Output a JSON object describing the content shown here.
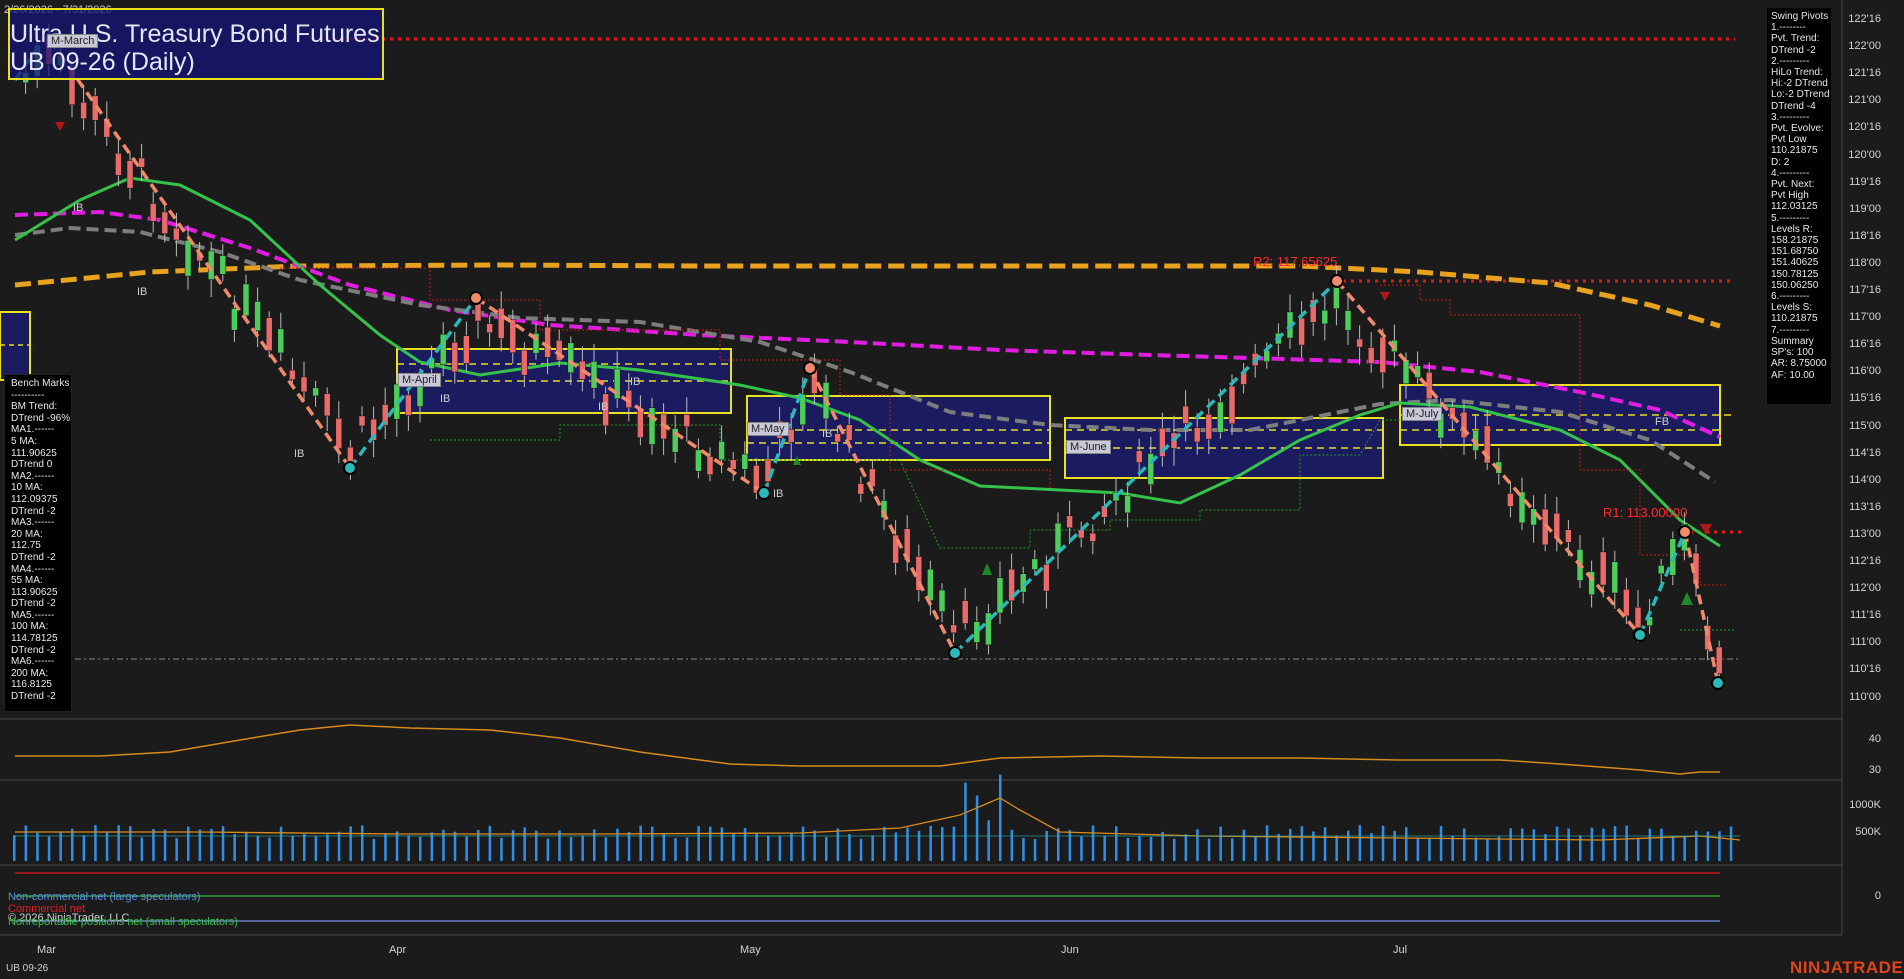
{
  "header": {
    "date_range": "2/26/2026 - 7/31/2026",
    "instrument": "Ultra U.S. Treasury Bond Futures",
    "contract": "UB 09-26 (Daily)"
  },
  "bench_marks": {
    "lines": [
      "Bench Marks",
      "----------",
      "BM Trend:",
      "DTrend -96%",
      "MA1.------",
      "5 MA:",
      "111.90625",
      "DTrend 0",
      "MA2.------",
      "10 MA:",
      "112.09375",
      "DTrend -2",
      "MA3.------",
      "20 MA:",
      "112.75",
      "DTrend -2",
      "MA4.------",
      "55 MA:",
      "113.90625",
      "DTrend -2",
      "MA5.------",
      "100 MA:",
      "114.78125",
      "DTrend -2",
      "MA6.------",
      "200 MA:",
      "116.8125",
      "DTrend -2"
    ]
  },
  "swing_pivots": {
    "lines": [
      "Swing Pivots",
      "1.--------",
      "Pvt. Trend:",
      "DTrend -2",
      "2.---------",
      "HiLo Trend:",
      "Hi:-2 DTrend",
      "Lo:-2 DTrend",
      "DTrend -4",
      "3.---------",
      "Pvt. Evolve:",
      "Pvt Low",
      "110.21875",
      "D: 2",
      "4.---------",
      "Pvt. Next:",
      "Pvt High",
      "112.03125",
      "5.---------",
      "Levels R:",
      "158.21875",
      "151.68750",
      "151.40625",
      "150.78125",
      "150.06250",
      "6.---------",
      "Levels S:",
      "110.21875",
      "7.---------",
      "Summary",
      "SP's: 100",
      "AR: 8.75000",
      "AF: 10.00"
    ]
  },
  "price_axis": [
    "122'16",
    "122'00",
    "121'16",
    "121'00",
    "120'16",
    "120'00",
    "119'16",
    "119'00",
    "118'16",
    "118'00",
    "117'16",
    "117'00",
    "116'16",
    "116'00",
    "115'16",
    "115'00",
    "114'16",
    "114'00",
    "113'16",
    "113'00",
    "112'16",
    "112'00",
    "111'16",
    "111'00",
    "110'16",
    "110'00"
  ],
  "osc_axis": [
    "40",
    "30"
  ],
  "volume_axis": [
    "1000K",
    "500K"
  ],
  "cot_axis": [
    "0"
  ],
  "time_axis": [
    "Mar",
    "Apr",
    "May",
    "Jun",
    "Jul"
  ],
  "levels": {
    "r2": "R2: 117.65625",
    "r1": "R1: 113.00000"
  },
  "month_labels": [
    "M-March",
    "M-April",
    "M-May",
    "M-June",
    "M-July"
  ],
  "marks": {
    "ib": "IB",
    "fb": "FB"
  },
  "cot_legend": {
    "noncommercial": "Non-commercial net (large speculators)",
    "commercial": "Commercial net",
    "nonreportable": "Nonreportable positions net (small speculators)"
  },
  "footer": {
    "copyright": "© 2026 NinjaTrader, LLC",
    "symbol": "UB 09-26",
    "brand": "NINJATRADER"
  },
  "colors": {
    "background": "#1b1b1b",
    "up_candle": "#4ccd5c",
    "down_candle": "#e86a6a",
    "ma_green": "#35c24a",
    "ma_magenta": "#e21de2",
    "ma_orange": "#e8a21e",
    "ma_gray": "#7a7a7a",
    "swing_up": "#2ab8b8",
    "swing_down": "#f08a6a",
    "resistance": "#e01818",
    "brand": "#e0451e"
  }
}
